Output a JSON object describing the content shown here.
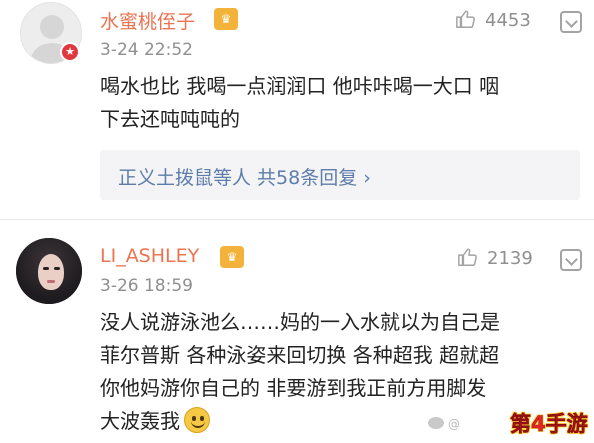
{
  "comments": [
    {
      "username": "水蜜桃侄子",
      "vip_badge": "♛",
      "avatar_badge": "★",
      "time": "3-24 22:52",
      "likes": "4453",
      "text_lines": [
        "喝水也比 我喝一点润润口 他咔咔喝一大口 咽",
        "下去还吨吨吨的"
      ],
      "replies_summary": "正义土拨鼠等人 共58条回复",
      "replies_chevron": "›",
      "like_icon": "thumbs-up-icon",
      "more_icon": "chevron-down-box-icon"
    },
    {
      "username": "LI_ASHLEY",
      "vip_badge": "♛",
      "time": "3-26 18:59",
      "likes": "2139",
      "text_lines": [
        "没人说游泳池么……妈的一入水就以为自己是",
        "菲尔普斯 各种泳姿来回切换 各种超我 超就超",
        "你他妈游你自己的 非要游到我正前方用脚发",
        "大波轰我"
      ],
      "emoji": "smile-emoji",
      "like_icon": "thumbs-up-icon",
      "more_icon": "chevron-down-box-icon"
    }
  ],
  "watermark_text": "@",
  "site_logo": "第4手游",
  "colors": {
    "username": "#eb7350",
    "link": "#5d7daa",
    "meta": "#8f8f8f",
    "badge_red": "#e0383e",
    "vip_gold": "#f3b23a"
  }
}
